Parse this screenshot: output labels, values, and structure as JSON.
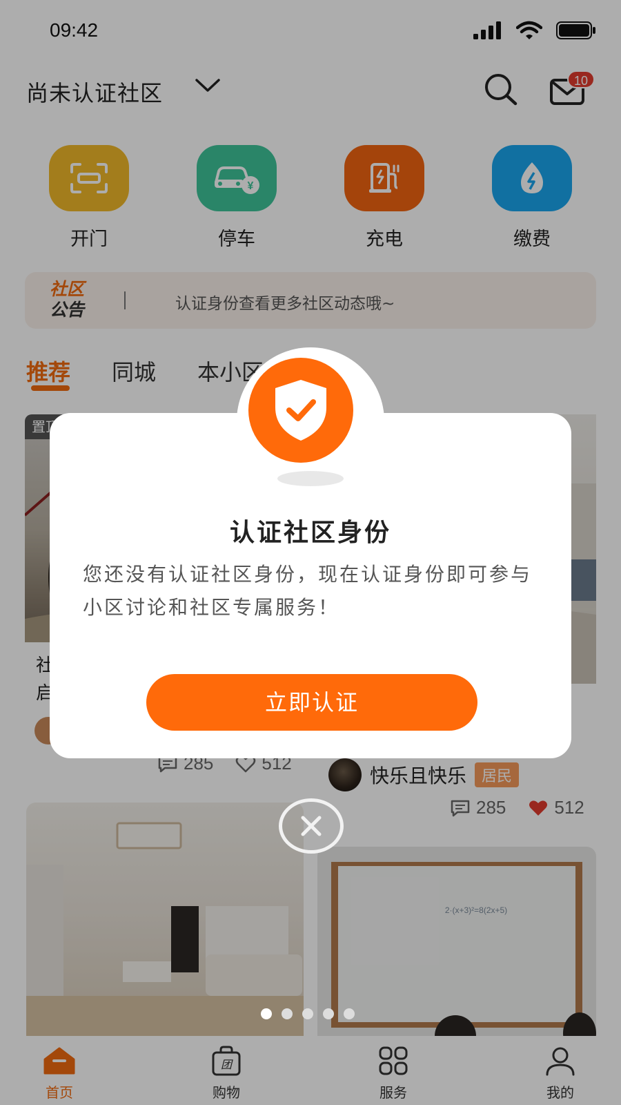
{
  "status_bar": {
    "time": "09:42"
  },
  "header": {
    "community_name": "尚未认证社区",
    "mail_badge_count": "10"
  },
  "quick_actions": [
    {
      "label": "开门",
      "icon": "scan-door-icon",
      "color": "#f1b92a"
    },
    {
      "label": "停车",
      "icon": "car-parking-icon",
      "color": "#3fc49a"
    },
    {
      "label": "充电",
      "icon": "charging-station-icon",
      "color": "#f26511"
    },
    {
      "label": "缴费",
      "icon": "payment-drop-icon",
      "color": "#1aa5ee"
    }
  ],
  "notice": {
    "logo_line1": "社区",
    "logo_line2": "公告",
    "text": "认证身份查看更多社区动态哦~"
  },
  "tabs": [
    {
      "label": "推荐",
      "active": true
    },
    {
      "label": "同城",
      "active": false
    },
    {
      "label": "本小区",
      "active": false
    }
  ],
  "feed": {
    "card1": {
      "badge": "置顶",
      "text_line1": "社",
      "text_line2": "启",
      "comments": "285",
      "likes": "512"
    },
    "card2": {
      "author": "快乐且快乐",
      "author_tag": "居民",
      "comments": "285",
      "likes": "512"
    }
  },
  "dialog": {
    "title": "认证社区身份",
    "body": "您还没有认证社区身份，现在认证身份即可参与小区讨论和社区专属服务！",
    "button": "立即认证"
  },
  "bottom_nav": [
    {
      "label": "首页",
      "icon": "home-icon",
      "active": true
    },
    {
      "label": "购物",
      "icon": "shopping-bag-icon",
      "active": false
    },
    {
      "label": "服务",
      "icon": "services-grid-icon",
      "active": false
    },
    {
      "label": "我的",
      "icon": "profile-icon",
      "active": false
    }
  ],
  "colors": {
    "accent": "#ff6a0a",
    "badge_red": "#e23b2e"
  }
}
